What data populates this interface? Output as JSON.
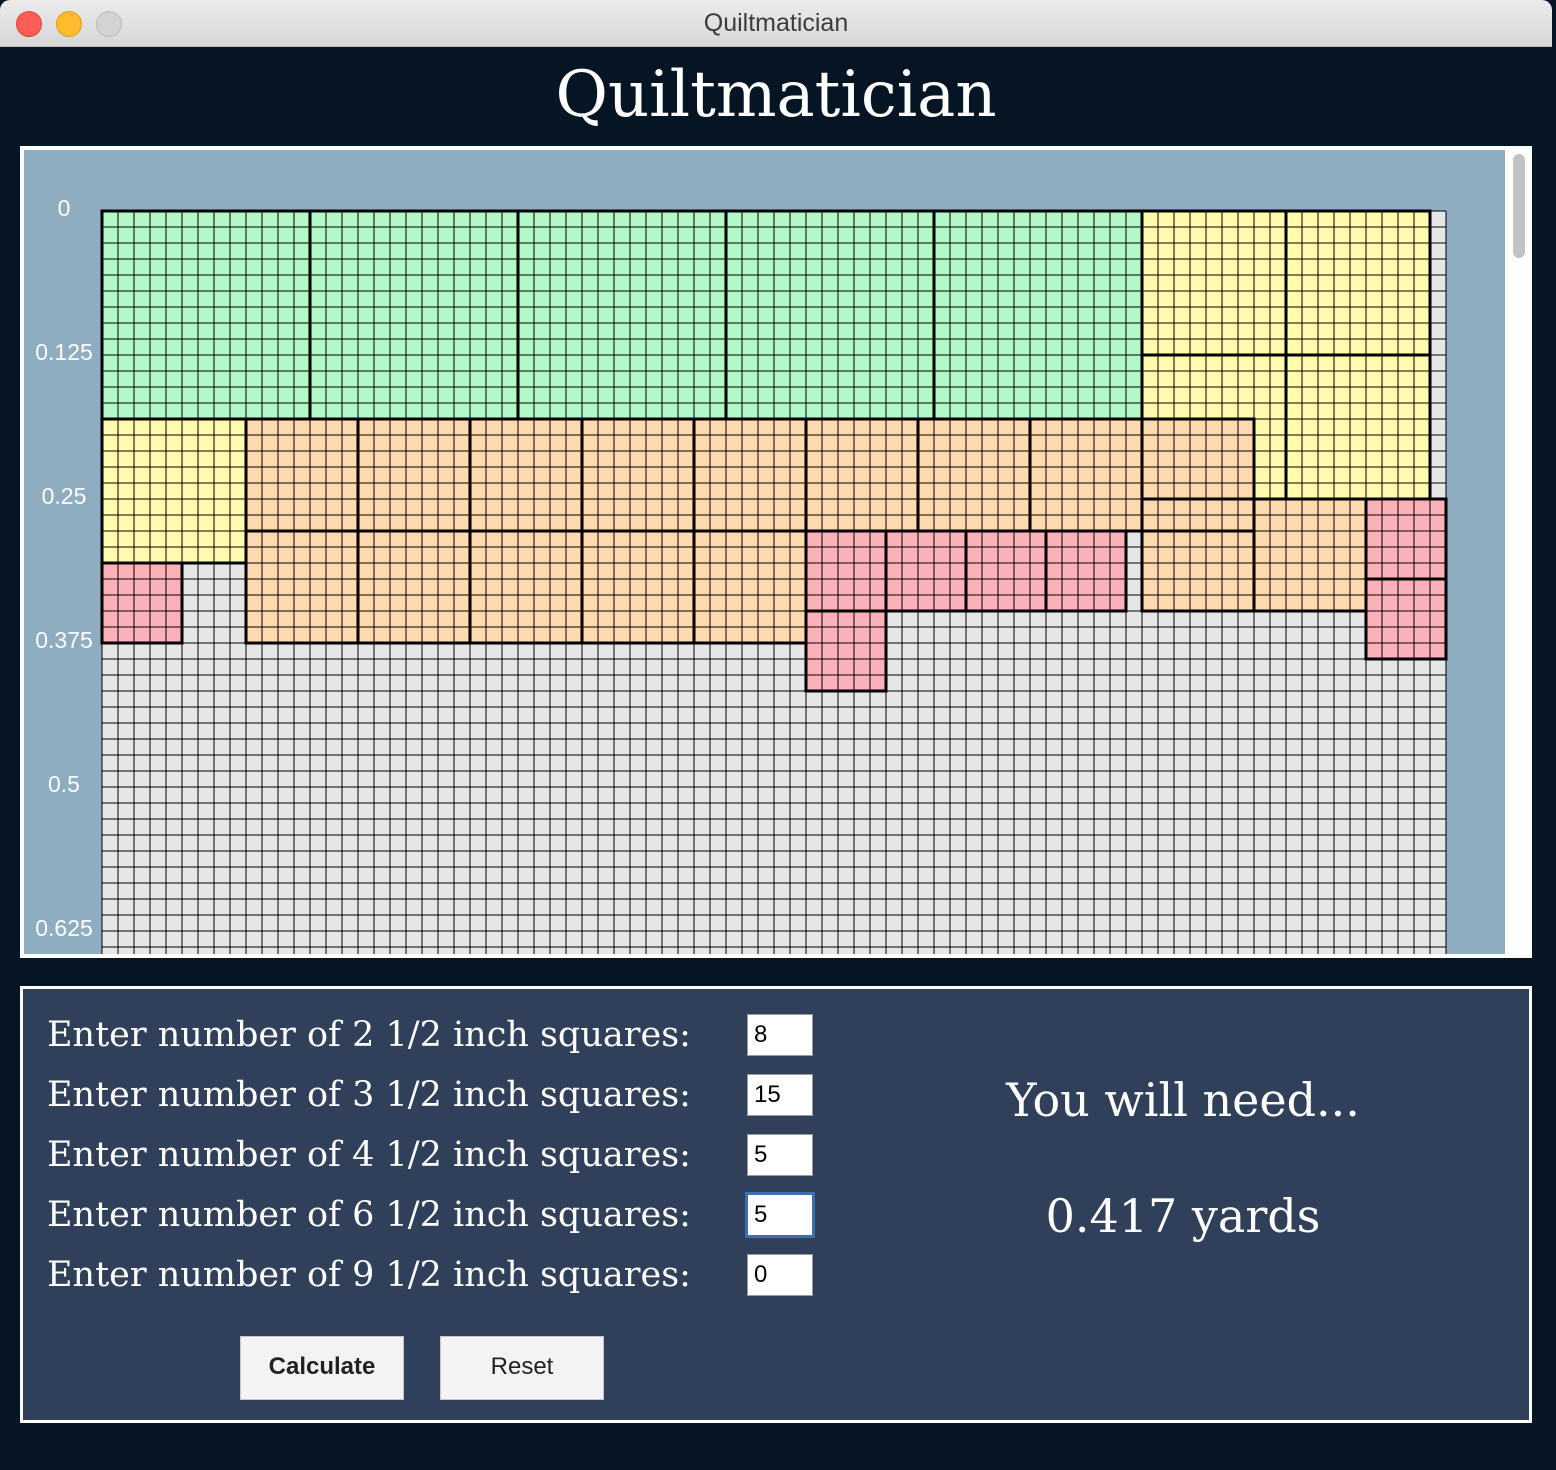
{
  "window": {
    "title": "Quiltmatician"
  },
  "app": {
    "heading": "Quiltmatician"
  },
  "canvas": {
    "y_axis_labels": [
      "0",
      "0.125",
      "0.25",
      "0.375",
      "0.5",
      "0.625"
    ],
    "colors": {
      "background": "#8fadc0",
      "empty_grid": "#e6e6e6",
      "square_6_5": "#b4f7c8",
      "square_4_5": "#fefcac",
      "square_3_5": "#fdd9b0",
      "square_2_5": "#fbb1b8"
    }
  },
  "form": {
    "rows": [
      {
        "label": "Enter number of 2 1/2 inch squares:",
        "value": "8"
      },
      {
        "label": "Enter number of 3 1/2 inch squares:",
        "value": "15"
      },
      {
        "label": "Enter number of 4 1/2 inch squares:",
        "value": "5"
      },
      {
        "label": "Enter number of 6 1/2 inch squares:",
        "value": "5"
      },
      {
        "label": "Enter number of 9 1/2 inch squares:",
        "value": "0"
      }
    ],
    "calculate_label": "Calculate",
    "reset_label": "Reset"
  },
  "result": {
    "prompt": "You will need...",
    "value": "0.417 yards"
  }
}
